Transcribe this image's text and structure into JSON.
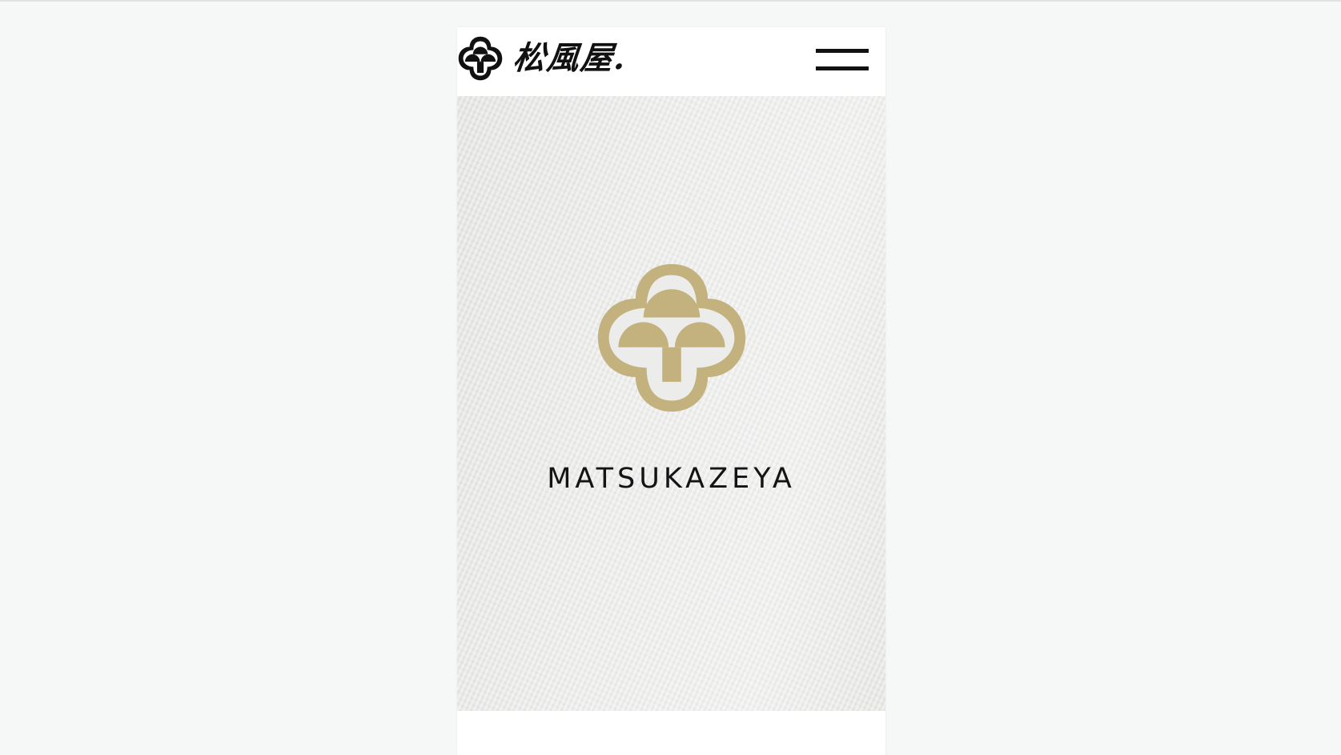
{
  "header": {
    "brand_name": "松風屋.",
    "logo_icon": "matsukazeya-crest-icon",
    "menu_icon": "hamburger-menu-icon"
  },
  "hero": {
    "emblem_icon": "matsukazeya-crest-icon",
    "wordmark": "MATSUKAZEYA"
  },
  "colors": {
    "page_background": "#f6f8f7",
    "emblem_gold": "#c3b17e",
    "ink": "#111111",
    "paper": "#ececeb"
  }
}
